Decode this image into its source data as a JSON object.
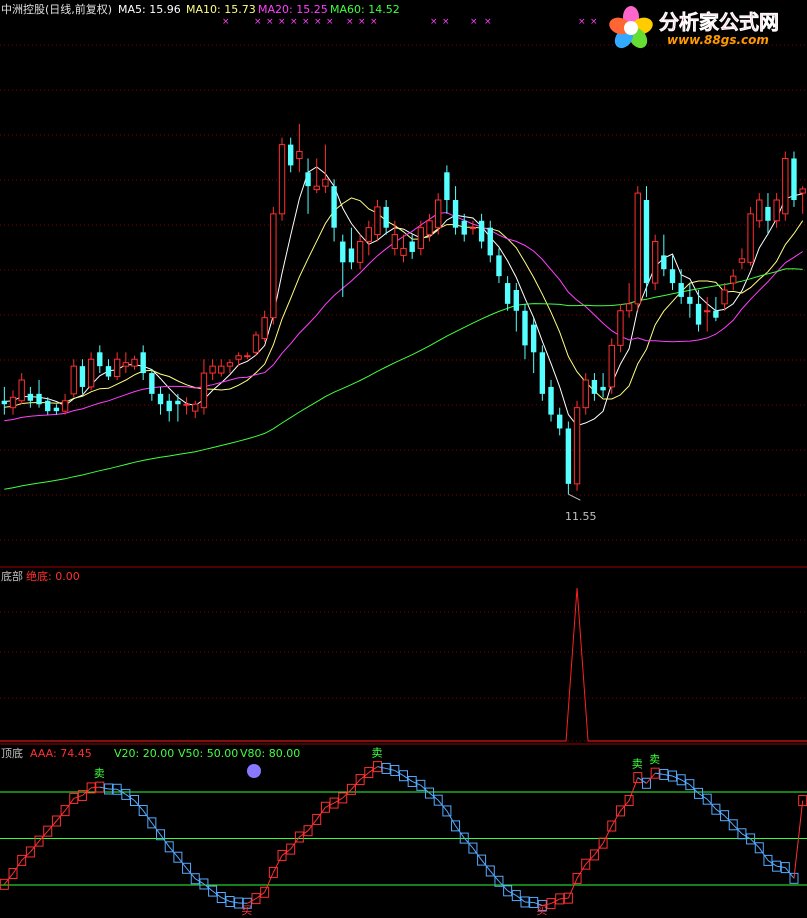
{
  "colors": {
    "background": "#000000",
    "up": "#ff3030",
    "down": "#55ffff",
    "ma5": "#ffffff",
    "ma10": "#ffff80",
    "ma20": "#ff40ff",
    "ma60": "#40ff40",
    "bottom_line": "#ff2020",
    "aaa_up": "#ff3030",
    "aaa_down": "#55aaff",
    "ref_lines": "#30ff30",
    "grid": "#800000",
    "panel_border": "#a00000"
  },
  "main_panel": {
    "title": "中洲控股(日线,前复权)",
    "ma5_label": "MA5: 15.96",
    "ma10_label": "MA10: 15.73",
    "ma20_label": "MA20: 15.25",
    "ma60_label": "MA60: 14.52",
    "low_annotation": "11.55"
  },
  "bottom_panel": {
    "title": "底部",
    "value_label": "绝底: 0.00"
  },
  "topbottom_panel": {
    "title": "顶底",
    "aaa_label": "AAA: 74.45",
    "v20_label": "V20: 20.00",
    "v50_label": "V50: 50.00",
    "v80_label": "V80: 80.00",
    "sell_marker": "卖",
    "buy_marker": "买"
  },
  "logo": {
    "text": "分析家公式网",
    "url": "www.88gs.com",
    "icon": "flower-icon"
  },
  "chart_data": [
    {
      "type": "candlestick",
      "title": "中洲控股(日线,前复权)",
      "series": [
        {
          "name": "MA5",
          "value": 15.96
        },
        {
          "name": "MA10",
          "value": 15.73
        },
        {
          "name": "MA20",
          "value": 15.25
        },
        {
          "name": "MA60",
          "value": 14.52
        }
      ],
      "ylim": [
        10.6,
        18.4
      ],
      "annotations": [
        "11.55"
      ],
      "ohlc": [
        [
          12.9,
          13.1,
          12.7,
          12.85
        ],
        [
          12.8,
          13.05,
          12.7,
          12.95
        ],
        [
          12.9,
          13.3,
          12.85,
          13.2
        ],
        [
          13.0,
          13.1,
          12.8,
          12.9
        ],
        [
          13.0,
          13.2,
          12.8,
          12.85
        ],
        [
          12.9,
          12.95,
          12.7,
          12.75
        ],
        [
          12.8,
          12.85,
          12.7,
          12.75
        ],
        [
          12.75,
          13.0,
          12.7,
          12.9
        ],
        [
          13.0,
          13.5,
          12.95,
          13.4
        ],
        [
          13.4,
          13.5,
          13.0,
          13.1
        ],
        [
          13.1,
          13.6,
          13.05,
          13.5
        ],
        [
          13.6,
          13.7,
          13.3,
          13.4
        ],
        [
          13.4,
          13.5,
          13.2,
          13.25
        ],
        [
          13.25,
          13.6,
          13.2,
          13.5
        ],
        [
          13.4,
          13.6,
          13.3,
          13.45
        ],
        [
          13.4,
          13.55,
          13.35,
          13.5
        ],
        [
          13.6,
          13.7,
          13.2,
          13.3
        ],
        [
          13.3,
          13.35,
          12.9,
          13.0
        ],
        [
          13.0,
          13.1,
          12.7,
          12.85
        ],
        [
          12.9,
          13.0,
          12.6,
          12.75
        ],
        [
          12.9,
          13.0,
          12.6,
          12.85
        ],
        [
          12.85,
          12.95,
          12.7,
          12.85
        ],
        [
          12.75,
          12.9,
          12.65,
          12.85
        ],
        [
          12.8,
          13.5,
          12.7,
          13.3
        ],
        [
          13.3,
          13.5,
          13.2,
          13.4
        ],
        [
          13.3,
          13.5,
          13.25,
          13.4
        ],
        [
          13.4,
          13.5,
          13.3,
          13.45
        ],
        [
          13.5,
          13.6,
          13.4,
          13.55
        ],
        [
          13.55,
          13.6,
          13.5,
          13.55
        ],
        [
          13.6,
          13.9,
          13.55,
          13.85
        ],
        [
          13.8,
          14.2,
          13.75,
          14.1
        ],
        [
          14.1,
          15.7,
          14.0,
          15.6
        ],
        [
          15.6,
          16.7,
          15.5,
          16.6
        ],
        [
          16.6,
          16.7,
          16.2,
          16.3
        ],
        [
          16.4,
          16.9,
          16.2,
          16.5
        ],
        [
          16.2,
          16.4,
          15.6,
          16.0
        ],
        [
          15.95,
          16.4,
          15.9,
          16.0
        ],
        [
          16.0,
          16.6,
          15.9,
          16.1
        ],
        [
          16.0,
          16.1,
          15.2,
          15.4
        ],
        [
          15.2,
          15.3,
          14.4,
          14.9
        ],
        [
          15.1,
          15.4,
          14.8,
          14.9
        ],
        [
          14.9,
          15.3,
          14.8,
          15.2
        ],
        [
          15.2,
          15.5,
          15.0,
          15.4
        ],
        [
          15.3,
          15.8,
          15.2,
          15.7
        ],
        [
          15.7,
          15.8,
          15.3,
          15.4
        ],
        [
          15.1,
          15.5,
          15.0,
          15.3
        ],
        [
          15.0,
          15.3,
          14.9,
          15.1
        ],
        [
          15.2,
          15.3,
          14.95,
          15.05
        ],
        [
          15.1,
          15.5,
          15.0,
          15.4
        ],
        [
          15.3,
          15.6,
          15.2,
          15.5
        ],
        [
          15.4,
          15.9,
          15.3,
          15.8
        ],
        [
          16.2,
          16.3,
          15.6,
          15.8
        ],
        [
          15.8,
          16.0,
          15.3,
          15.4
        ],
        [
          15.5,
          15.6,
          15.2,
          15.3
        ],
        [
          15.4,
          15.5,
          15.3,
          15.4
        ],
        [
          15.5,
          15.6,
          15.1,
          15.2
        ],
        [
          15.4,
          15.5,
          14.9,
          15.0
        ],
        [
          15.0,
          15.1,
          14.6,
          14.7
        ],
        [
          14.6,
          14.7,
          14.2,
          14.3
        ],
        [
          14.5,
          14.6,
          13.9,
          14.2
        ],
        [
          14.2,
          14.3,
          13.5,
          13.7
        ],
        [
          14.0,
          14.1,
          13.3,
          13.6
        ],
        [
          13.6,
          13.7,
          12.9,
          13.0
        ],
        [
          13.1,
          13.2,
          12.6,
          12.7
        ],
        [
          12.7,
          12.8,
          12.4,
          12.5
        ],
        [
          12.5,
          12.6,
          11.55,
          11.7
        ],
        [
          11.7,
          12.9,
          11.6,
          12.8
        ],
        [
          12.8,
          13.3,
          12.7,
          13.2
        ],
        [
          13.2,
          13.3,
          12.9,
          13.0
        ],
        [
          13.1,
          13.3,
          12.95,
          13.05
        ],
        [
          13.1,
          13.8,
          13.0,
          13.7
        ],
        [
          13.7,
          14.3,
          13.6,
          14.2
        ],
        [
          14.2,
          14.6,
          14.1,
          14.3
        ],
        [
          14.3,
          16.0,
          14.2,
          15.9
        ],
        [
          15.8,
          16.0,
          14.4,
          14.6
        ],
        [
          14.6,
          15.3,
          14.5,
          15.2
        ],
        [
          15.0,
          15.3,
          14.7,
          14.8
        ],
        [
          14.8,
          15.0,
          14.5,
          14.6
        ],
        [
          14.6,
          14.8,
          14.3,
          14.4
        ],
        [
          14.4,
          14.6,
          14.1,
          14.3
        ],
        [
          14.3,
          14.5,
          13.9,
          14.0
        ],
        [
          14.2,
          14.4,
          13.9,
          14.2
        ],
        [
          14.2,
          14.4,
          14.05,
          14.1
        ],
        [
          14.3,
          14.6,
          14.2,
          14.5
        ],
        [
          14.6,
          14.8,
          14.5,
          14.7
        ],
        [
          14.9,
          15.1,
          14.8,
          14.95
        ],
        [
          14.9,
          15.7,
          14.85,
          15.6
        ],
        [
          15.5,
          15.9,
          15.4,
          15.8
        ],
        [
          15.7,
          15.9,
          15.3,
          15.5
        ],
        [
          15.5,
          15.9,
          15.4,
          15.8
        ],
        [
          15.6,
          16.5,
          15.5,
          16.4
        ],
        [
          16.4,
          16.5,
          15.7,
          15.8
        ],
        [
          15.9,
          16.0,
          15.6,
          15.96
        ]
      ]
    },
    {
      "type": "line",
      "title": "底部",
      "series": [
        {
          "name": "绝底",
          "value": 0.0
        }
      ]
    },
    {
      "type": "line",
      "title": "顶底",
      "series": [
        {
          "name": "AAA",
          "value": 74.45
        },
        {
          "name": "V20",
          "value": 20.0
        },
        {
          "name": "V50",
          "value": 50.0
        },
        {
          "name": "V80",
          "value": 80.0
        }
      ]
    }
  ]
}
